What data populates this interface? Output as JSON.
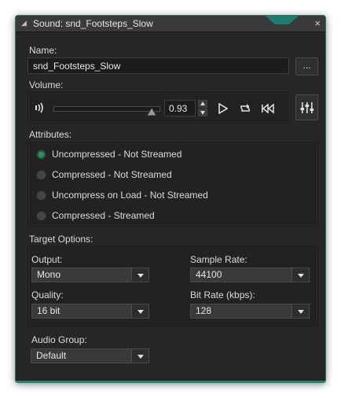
{
  "window": {
    "title": "Sound: snd_Footsteps_Slow",
    "close_glyph": "×"
  },
  "name": {
    "label": "Name:",
    "value": "snd_Footsteps_Slow",
    "browse_label": "..."
  },
  "volume": {
    "label": "Volume:",
    "value": "0.93",
    "level": 0.93
  },
  "attributes": {
    "label": "Attributes:",
    "options": [
      {
        "label": "Uncompressed - Not Streamed",
        "selected": true
      },
      {
        "label": "Compressed - Not Streamed",
        "selected": false
      },
      {
        "label": "Uncompress on Load - Not Streamed",
        "selected": false
      },
      {
        "label": "Compressed - Streamed",
        "selected": false
      }
    ]
  },
  "target": {
    "label": "Target Options:",
    "output": {
      "label": "Output:",
      "value": "Mono"
    },
    "sample_rate": {
      "label": "Sample Rate:",
      "value": "44100"
    },
    "quality": {
      "label": "Quality:",
      "value": "16 bit"
    },
    "bit_rate": {
      "label": "Bit Rate (kbps):",
      "value": "128"
    }
  },
  "audio_group": {
    "label": "Audio Group:",
    "value": "Default"
  },
  "colors": {
    "accent": "#1f8a78",
    "radio_on": "#1f9a5c",
    "window_bg": "#262626"
  },
  "icons": [
    "speaker-icon",
    "play-icon",
    "loop-icon",
    "rewind-icon",
    "mixer-icon",
    "chevron-down-icon",
    "close-icon"
  ]
}
